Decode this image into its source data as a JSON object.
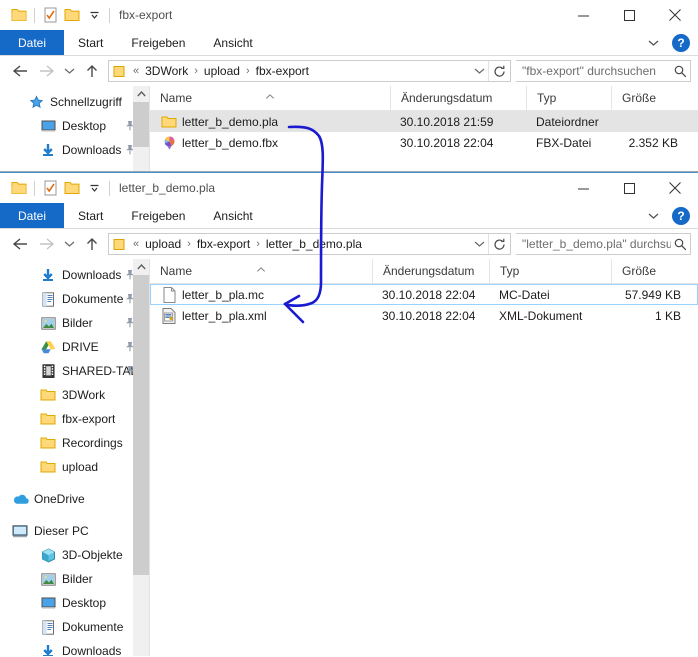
{
  "windows": [
    {
      "id": "window-fbx-export",
      "title": "fbx-export",
      "quick_access": [
        "folder-icon",
        "properties-icon",
        "new-folder-icon",
        "chevron-down-icon"
      ],
      "caption": {
        "minimize": "minimize-icon",
        "maximize": "maximize-icon",
        "close": "close-icon"
      },
      "ribbon": {
        "tabs": [
          "Datei",
          "Start",
          "Freigeben",
          "Ansicht"
        ],
        "help_label": "?"
      },
      "address": {
        "crumbs": [
          "3DWork",
          "upload",
          "fbx-export"
        ],
        "overflow": "«"
      },
      "search": {
        "placeholder": "\"fbx-export\" durchsuchen"
      },
      "columns": [
        "Name",
        "Änderungsdatum",
        "Typ",
        "Größe"
      ],
      "rows": [
        {
          "name": "letter_b_demo.pla",
          "date": "30.10.2018 21:59",
          "type": "Dateiordner",
          "size": "",
          "icon": "folder-icon",
          "selected": true
        },
        {
          "name": "letter_b_demo.fbx",
          "date": "30.10.2018 22:04",
          "type": "FBX-Datei",
          "size": "2.352 KB",
          "icon": "fbx-file-icon",
          "selected": false
        }
      ],
      "nav_items": [
        {
          "label": "Schnellzugriff",
          "icon": "star-icon",
          "level": 0,
          "pin": false
        },
        {
          "label": "Desktop",
          "icon": "desktop-icon",
          "level": 1,
          "pin": true
        },
        {
          "label": "Downloads",
          "icon": "download-icon",
          "level": 1,
          "pin": true
        }
      ]
    },
    {
      "id": "window-letter-b-demo-pla",
      "title": "letter_b_demo.pla",
      "quick_access": [
        "folder-icon",
        "properties-icon",
        "new-folder-icon",
        "chevron-down-icon"
      ],
      "caption": {
        "minimize": "minimize-icon",
        "maximize": "maximize-icon",
        "close": "close-icon"
      },
      "ribbon": {
        "tabs": [
          "Datei",
          "Start",
          "Freigeben",
          "Ansicht"
        ],
        "help_label": "?"
      },
      "address": {
        "crumbs": [
          "upload",
          "fbx-export",
          "letter_b_demo.pla"
        ],
        "overflow": "«"
      },
      "search": {
        "placeholder": "\"letter_b_demo.pla\" durchsuc"
      },
      "columns": [
        "Name",
        "Änderungsdatum",
        "Typ",
        "Größe"
      ],
      "rows": [
        {
          "name": "letter_b_pla.mc",
          "date": "30.10.2018 22:04",
          "type": "MC-Datei",
          "size": "57.949 KB",
          "icon": "generic-file-icon",
          "focused": true
        },
        {
          "name": "letter_b_pla.xml",
          "date": "30.10.2018 22:04",
          "type": "XML-Dokument",
          "size": "1 KB",
          "icon": "xml-file-icon",
          "focused": false
        }
      ],
      "nav_items": [
        {
          "label": "Downloads",
          "icon": "download-icon",
          "level": 1,
          "pin": true
        },
        {
          "label": "Dokumente",
          "icon": "documents-icon",
          "level": 1,
          "pin": true
        },
        {
          "label": "Bilder",
          "icon": "pictures-icon",
          "level": 1,
          "pin": true
        },
        {
          "label": "DRIVE",
          "icon": "google-drive-icon",
          "level": 1,
          "pin": true
        },
        {
          "label": "SHARED-TAL",
          "icon": "film-icon",
          "level": 1,
          "pin": true
        },
        {
          "label": "3DWork",
          "icon": "folder-icon",
          "level": 1,
          "pin": false
        },
        {
          "label": "fbx-export",
          "icon": "folder-icon",
          "level": 1,
          "pin": false
        },
        {
          "label": "Recordings",
          "icon": "folder-icon",
          "level": 1,
          "pin": false
        },
        {
          "label": "upload",
          "icon": "folder-icon",
          "level": 1,
          "pin": false
        },
        {
          "label": "OneDrive",
          "icon": "onedrive-icon",
          "level": 0,
          "pin": false
        },
        {
          "label": "Dieser PC",
          "icon": "this-pc-icon",
          "level": 0,
          "pin": false
        },
        {
          "label": "3D-Objekte",
          "icon": "3d-objects-icon",
          "level": 1,
          "pin": false
        },
        {
          "label": "Bilder",
          "icon": "pictures-icon",
          "level": 1,
          "pin": false
        },
        {
          "label": "Desktop",
          "icon": "desktop-icon",
          "level": 1,
          "pin": false
        },
        {
          "label": "Dokumente",
          "icon": "documents-icon",
          "level": 1,
          "pin": false
        },
        {
          "label": "Downloads",
          "icon": "download-icon",
          "level": 1,
          "pin": false
        }
      ]
    }
  ],
  "annotation": {
    "name": "blue-arrow-annotation",
    "color": "#1a1ad0",
    "description": "Hand-drawn arrow linking letter_b_demo.pla folder to letter_b_pla.mc file"
  }
}
